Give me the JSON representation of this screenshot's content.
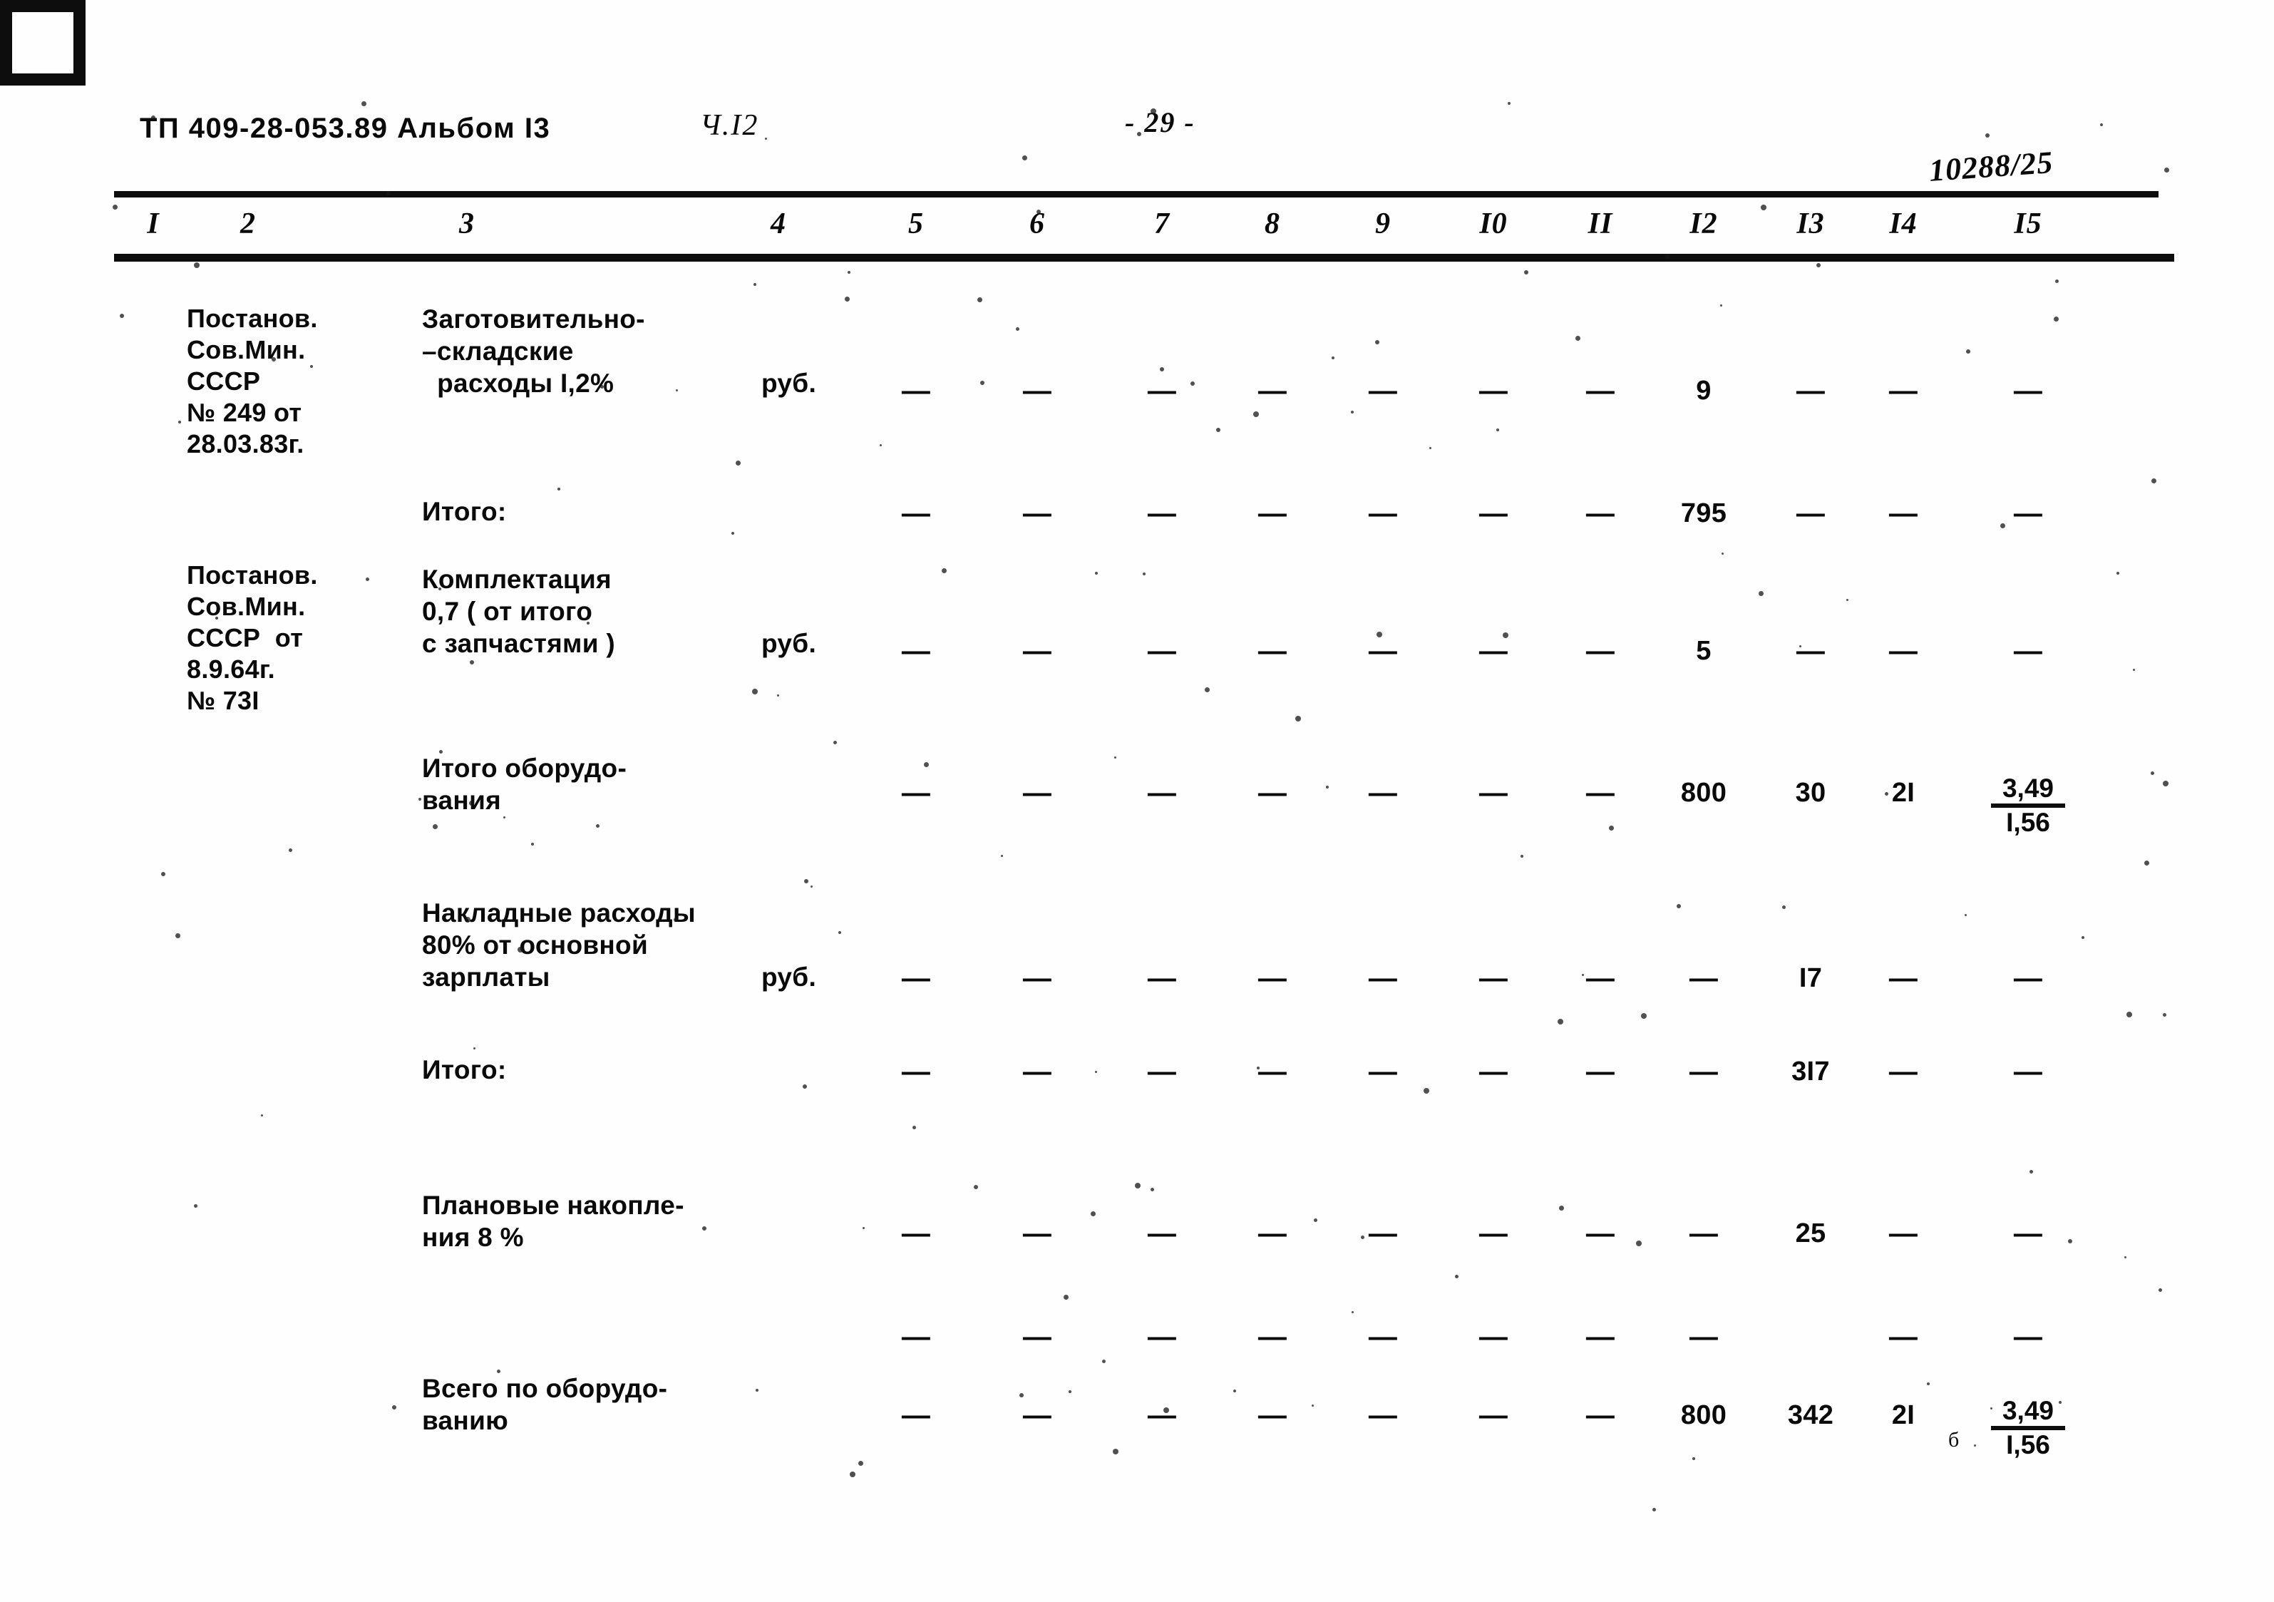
{
  "header": {
    "document_code": "ТП 409-28-053.89 Альбом I3",
    "part": "Ч.I2",
    "page_number": "- 29 -",
    "archive_stamp": "10288/25"
  },
  "table": {
    "column_numbers": [
      "I",
      "2",
      "3",
      "4",
      "5",
      "6",
      "7",
      "8",
      "9",
      "I0",
      "II",
      "I2",
      "I3",
      "I4",
      "I5"
    ],
    "dash": "—",
    "rows": [
      {
        "name": "row-zagotovitelno-skladskie",
        "source": "Постанов.\nСов.Мин.\nСССР\n№ 249 от\n28.03.83г.",
        "description": "Заготовительно-\n–складские\n  расходы I,2%",
        "unit": "руб.",
        "values": [
          "—",
          "—",
          "—",
          "—",
          "—",
          "—",
          "—",
          "9",
          "—",
          "—",
          "—"
        ]
      },
      {
        "name": "row-itogo-1",
        "source": "",
        "description": "Итого:",
        "unit": "",
        "values": [
          "—",
          "—",
          "—",
          "—",
          "—",
          "—",
          "—",
          "795",
          "—",
          "—",
          "—"
        ]
      },
      {
        "name": "row-komplektatsiya",
        "source": "Постанов.\nСов.Мин.\nСССР  от\n8.9.64г.\n№ 73I",
        "description": "Комплектация\n0,7 ( от итого\nс запчастями )",
        "unit": "руб.",
        "values": [
          "—",
          "—",
          "—",
          "—",
          "—",
          "—",
          "—",
          "5",
          "—",
          "—",
          "—"
        ]
      },
      {
        "name": "row-itogo-oborudovaniya",
        "source": "",
        "description": "Итого оборудо-\nвания",
        "unit": "",
        "values": [
          "—",
          "—",
          "—",
          "—",
          "—",
          "—",
          "—",
          "800",
          "30",
          "2I",
          ""
        ],
        "fraction": {
          "numerator": "3,49",
          "denominator": "I,56"
        }
      },
      {
        "name": "row-nakladnye-raskhody",
        "source": "",
        "description": "Накладные расходы\n80% от основной\nзарплаты",
        "unit": "руб.",
        "values": [
          "—",
          "—",
          "—",
          "—",
          "—",
          "—",
          "—",
          "—",
          "I7",
          "—",
          "—"
        ]
      },
      {
        "name": "row-itogo-2",
        "source": "",
        "description": "Итого:",
        "unit": "",
        "values": [
          "—",
          "—",
          "—",
          "—",
          "—",
          "—",
          "—",
          "—",
          "3I7",
          "—",
          "—"
        ]
      },
      {
        "name": "row-planovye-nakopleniya",
        "source": "",
        "description": "Плановые накопле-\nния 8 %",
        "unit": "",
        "values": [
          "—",
          "—",
          "—",
          "—",
          "—",
          "—",
          "—",
          "—",
          "25",
          "—",
          "—"
        ]
      },
      {
        "name": "row-blank",
        "source": "",
        "description": "",
        "unit": "",
        "values": [
          "—",
          "—",
          "—",
          "—",
          "—",
          "—",
          "—",
          "—",
          "",
          "—",
          "—"
        ]
      },
      {
        "name": "row-vsego-po-oborudovaniyu",
        "source": "",
        "description": "Всего по оборудо-\nванию",
        "unit": "",
        "values": [
          "—",
          "—",
          "—",
          "—",
          "—",
          "—",
          "—",
          "800",
          "342",
          "2I",
          ""
        ],
        "fraction": {
          "numerator": "3,49",
          "denominator": "I,56"
        },
        "side_mark": "б"
      }
    ]
  }
}
